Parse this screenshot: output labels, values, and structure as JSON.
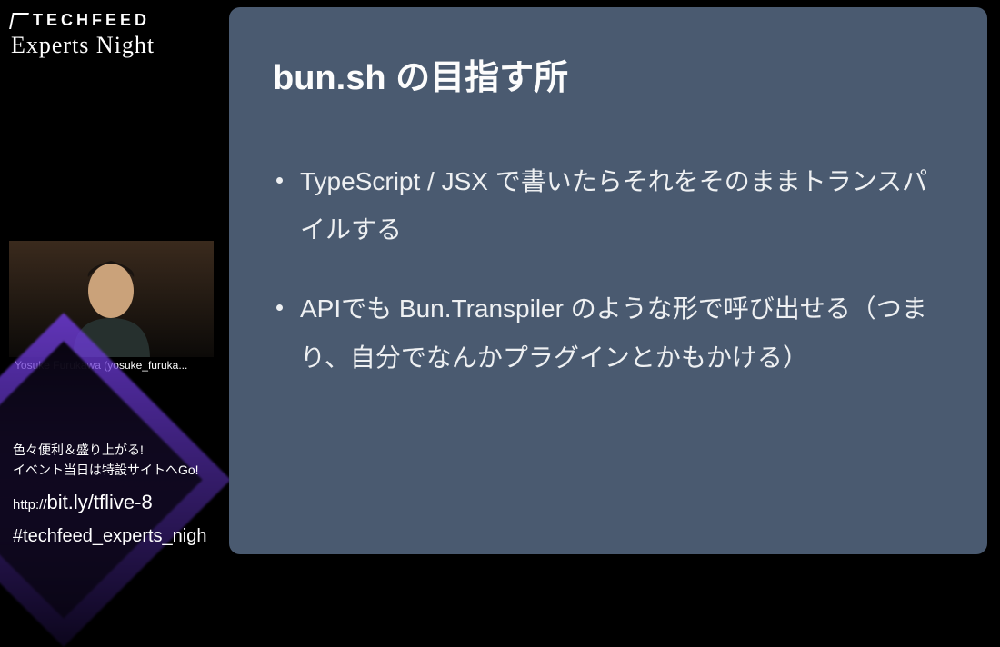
{
  "brand": {
    "name": "TECHFEED",
    "subtitle": "Experts Night"
  },
  "speaker": {
    "nametag": "Yosuke Furukawa (yosuke_furuka..."
  },
  "promo": {
    "line1": "色々便利＆盛り上がる!",
    "line2": "イベント当日は特設サイトへGo!",
    "url_prefix": "http://",
    "url_main": "bit.ly/tflive-8",
    "hashtag": "#techfeed_experts_nigh"
  },
  "slide": {
    "title": "bun.sh の目指す所",
    "bullets": [
      "TypeScript / JSX で書いたらそれをそのままトランスパイルする",
      "APIでも Bun.Transpiler のような形で呼び出せる（つまり、自分でなんかプラグインとかもかける）"
    ]
  }
}
